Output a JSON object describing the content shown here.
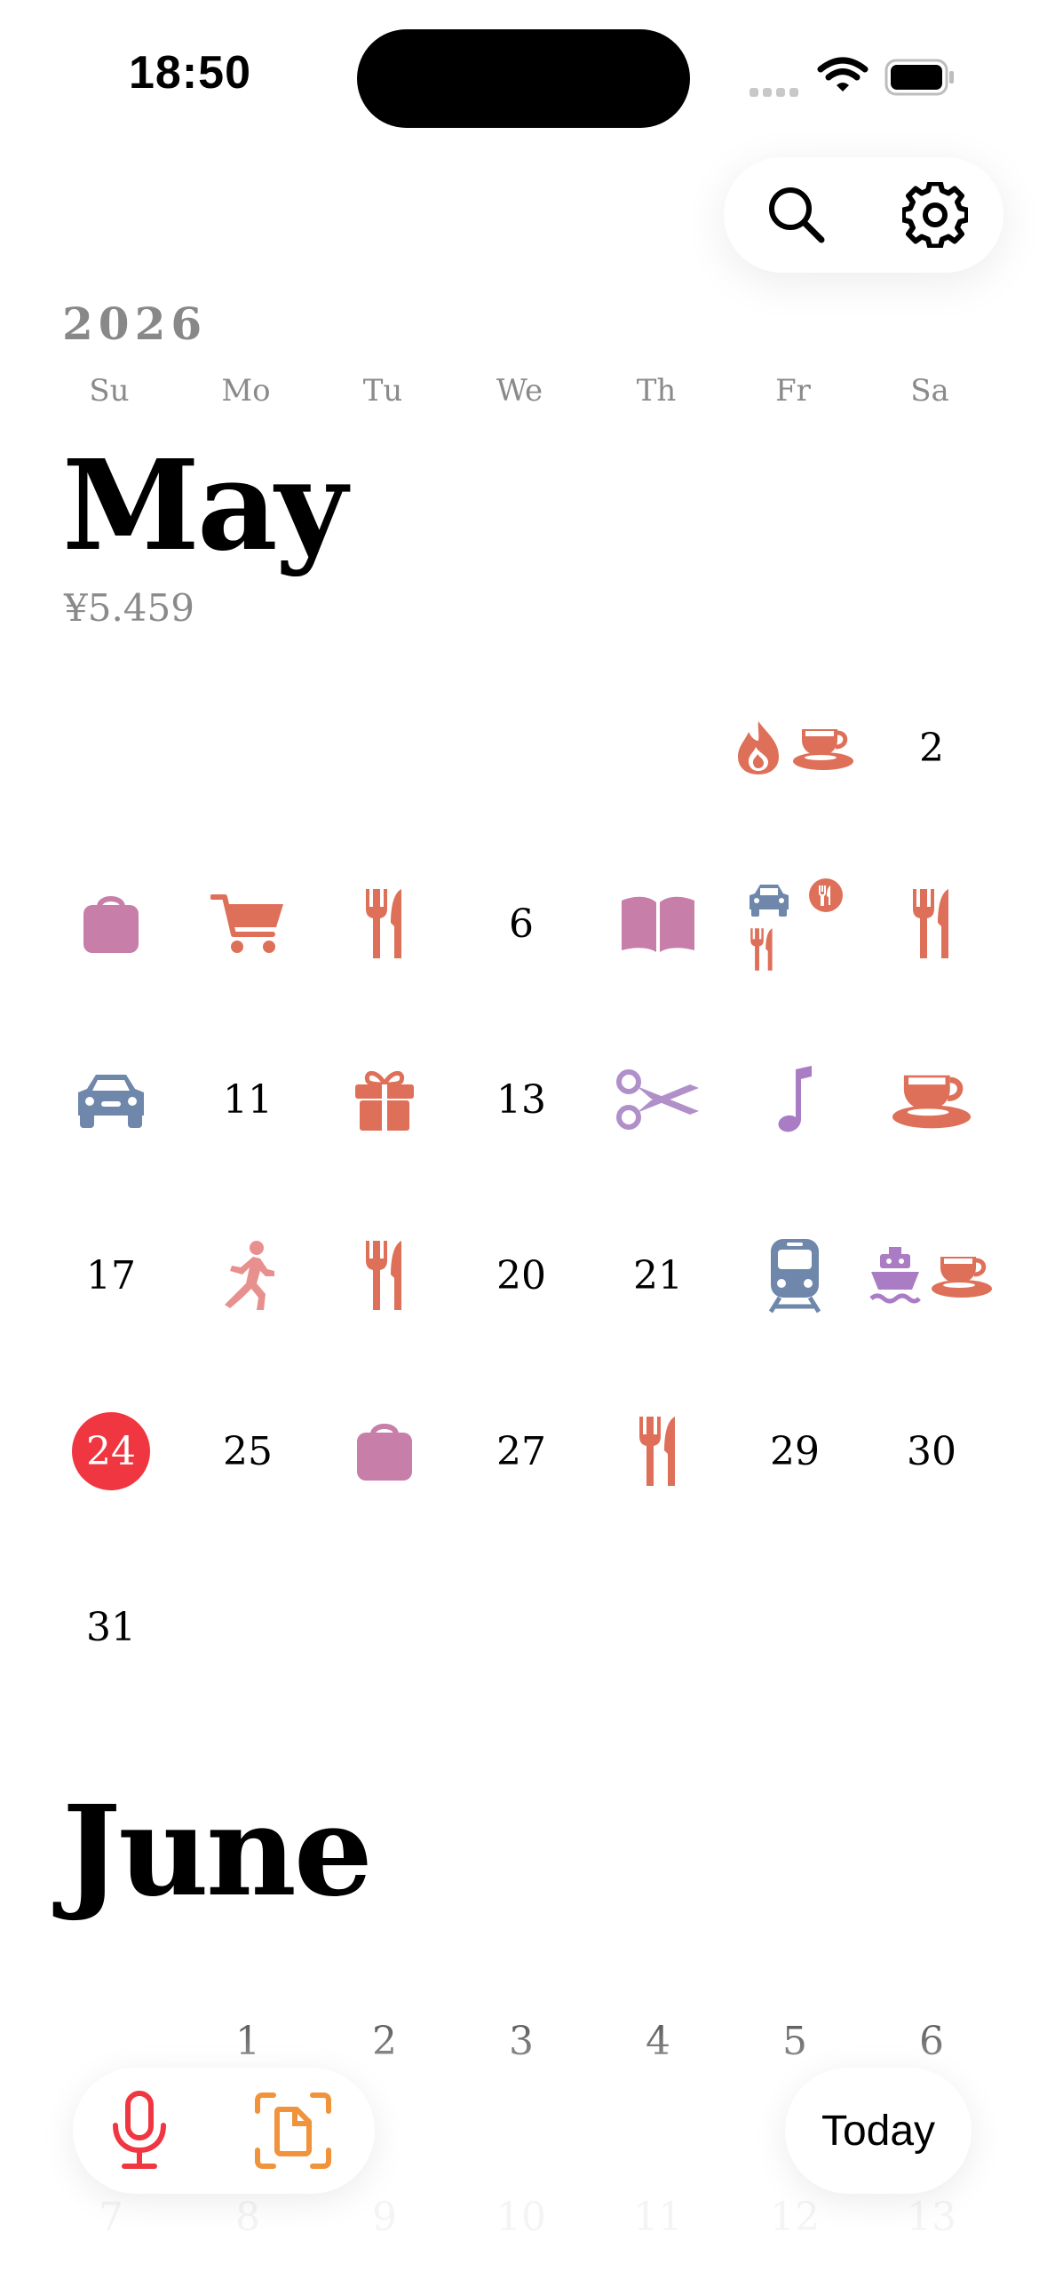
{
  "status": {
    "time": "18:50"
  },
  "calendar": {
    "year": "2026",
    "weekdays": [
      "Su",
      "Mo",
      "Tu",
      "We",
      "Th",
      "Fr",
      "Sa"
    ],
    "may": {
      "title": "May",
      "total": "¥5.459",
      "days": {
        "d2": "2",
        "d6": "6",
        "d11": "11",
        "d13": "13",
        "d17": "17",
        "d20": "20",
        "d21": "21",
        "d24": "24",
        "d25": "25",
        "d27": "27",
        "d29": "29",
        "d30": "30",
        "d31": "31"
      },
      "icons": {
        "d1": [
          "fire-icon",
          "coffee-icon"
        ],
        "d3": [
          "bag-icon"
        ],
        "d4": [
          "cart-icon"
        ],
        "d5": [
          "cutlery-icon"
        ],
        "d7": [
          "book-icon"
        ],
        "d8": [
          "car-icon",
          "cutlery-icon",
          "cutlery-badge-icon"
        ],
        "d9": [
          "cutlery-icon"
        ],
        "d10": [
          "car-icon"
        ],
        "d12": [
          "gift-icon"
        ],
        "d14": [
          "scissors-icon"
        ],
        "d15": [
          "music-note-icon"
        ],
        "d16": [
          "coffee-icon"
        ],
        "d18": [
          "running-icon"
        ],
        "d19": [
          "cutlery-icon"
        ],
        "d22": [
          "train-icon"
        ],
        "d23": [
          "ship-icon",
          "coffee-icon"
        ],
        "d26": [
          "bag-icon"
        ],
        "d28": [
          "cutlery-icon"
        ]
      }
    },
    "june": {
      "title": "June",
      "week1": [
        "1",
        "2",
        "3",
        "4",
        "5",
        "6"
      ],
      "week2": [
        "7",
        "8",
        "9",
        "10",
        "11",
        "12",
        "13"
      ]
    }
  },
  "toolbar": {
    "today_label": "Today",
    "mic_icon": "microphone-icon",
    "scan_icon": "document-scan-icon"
  },
  "colors": {
    "accent_red": "#f03640",
    "terracotta": "#de7059",
    "rose": "#c77ea8",
    "slate": "#6e87aa",
    "purple": "#a97cc4",
    "orange": "#f0933a"
  }
}
